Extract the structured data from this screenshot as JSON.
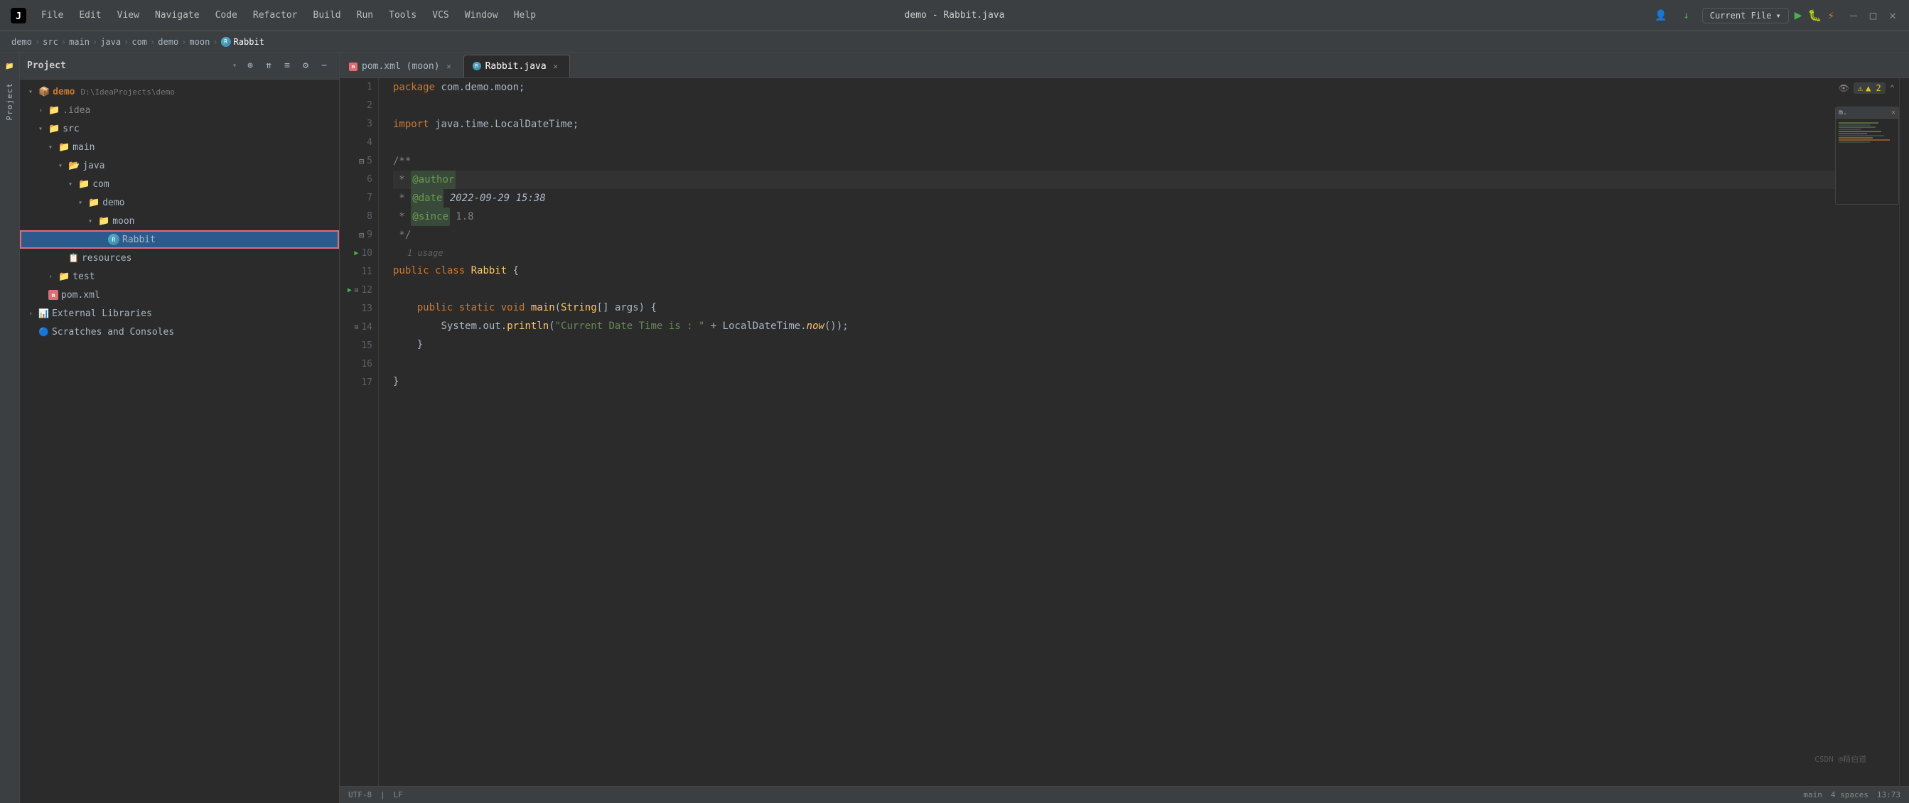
{
  "titleBar": {
    "title": "demo - Rabbit.java",
    "menus": [
      "File",
      "Edit",
      "View",
      "Navigate",
      "Code",
      "Refactor",
      "Build",
      "Run",
      "Tools",
      "VCS",
      "Window",
      "Help"
    ],
    "runConfig": "Current File"
  },
  "breadcrumb": {
    "items": [
      "demo",
      "src",
      "main",
      "java",
      "com",
      "demo",
      "moon",
      "Rabbit"
    ]
  },
  "projectPanel": {
    "title": "Project",
    "tree": [
      {
        "id": "demo-root",
        "label": "demo",
        "path": "D:\\IdeaProjects\\demo",
        "level": 0,
        "type": "module",
        "expanded": true
      },
      {
        "id": "idea",
        "label": ".idea",
        "level": 1,
        "type": "folder",
        "expanded": false
      },
      {
        "id": "src",
        "label": "src",
        "level": 1,
        "type": "folder",
        "expanded": true
      },
      {
        "id": "main",
        "label": "main",
        "level": 2,
        "type": "folder",
        "expanded": true
      },
      {
        "id": "java",
        "label": "java",
        "level": 3,
        "type": "folder-src",
        "expanded": true
      },
      {
        "id": "com",
        "label": "com",
        "level": 4,
        "type": "folder",
        "expanded": true
      },
      {
        "id": "demo2",
        "label": "demo",
        "level": 5,
        "type": "folder",
        "expanded": true
      },
      {
        "id": "moon",
        "label": "moon",
        "level": 6,
        "type": "folder",
        "expanded": true
      },
      {
        "id": "rabbit",
        "label": "Rabbit",
        "level": 7,
        "type": "java",
        "selected": true
      },
      {
        "id": "resources",
        "label": "resources",
        "level": 3,
        "type": "resources"
      },
      {
        "id": "test",
        "label": "test",
        "level": 2,
        "type": "folder",
        "expanded": false
      },
      {
        "id": "pomxml",
        "label": "pom.xml",
        "level": 1,
        "type": "xml"
      },
      {
        "id": "extlib",
        "label": "External Libraries",
        "level": 0,
        "type": "extlib",
        "expanded": false
      },
      {
        "id": "scratches",
        "label": "Scratches and Consoles",
        "level": 0,
        "type": "scratches"
      }
    ]
  },
  "tabs": [
    {
      "id": "pom-tab",
      "label": "pom.xml (moon)",
      "active": false,
      "type": "xml"
    },
    {
      "id": "rabbit-tab",
      "label": "Rabbit.java",
      "active": true,
      "type": "java"
    }
  ],
  "editor": {
    "filename": "Rabbit.java",
    "lines": [
      {
        "num": 1,
        "content": "package com.demo.moon;",
        "type": "code"
      },
      {
        "num": 2,
        "content": "",
        "type": "empty"
      },
      {
        "num": 3,
        "content": "import java.time.LocalDateTime;",
        "type": "code"
      },
      {
        "num": 4,
        "content": "",
        "type": "empty"
      },
      {
        "num": 5,
        "content": "/**",
        "type": "comment-start",
        "foldable": true
      },
      {
        "num": 6,
        "content": " * @author",
        "type": "comment",
        "annotated": true
      },
      {
        "num": 7,
        "content": " * @date 2022-09-29 15:38",
        "type": "comment",
        "annotated": true
      },
      {
        "num": 8,
        "content": " * @since 1.8",
        "type": "comment",
        "annotated": true
      },
      {
        "num": 9,
        "content": " */",
        "type": "comment-end",
        "foldable": true
      },
      {
        "num": 10,
        "content": "public class Rabbit {",
        "type": "code",
        "runnable": true
      },
      {
        "num": 11,
        "content": "",
        "type": "empty"
      },
      {
        "num": 12,
        "content": "    public static void main(String[] args) {",
        "type": "code",
        "runnable": true,
        "foldable": true
      },
      {
        "num": 13,
        "content": "        System.out.println(\"Current Date Time is : \" + LocalDateTime.now());",
        "type": "code"
      },
      {
        "num": 14,
        "content": "    }",
        "type": "code",
        "foldable": true
      },
      {
        "num": 15,
        "content": "",
        "type": "empty"
      },
      {
        "num": 16,
        "content": "}",
        "type": "code"
      },
      {
        "num": 17,
        "content": "",
        "type": "empty"
      }
    ],
    "usageHint": "1 usage",
    "warningCount": "▲ 2"
  },
  "statusBar": {
    "watermark": "CSDN @精伯道"
  }
}
